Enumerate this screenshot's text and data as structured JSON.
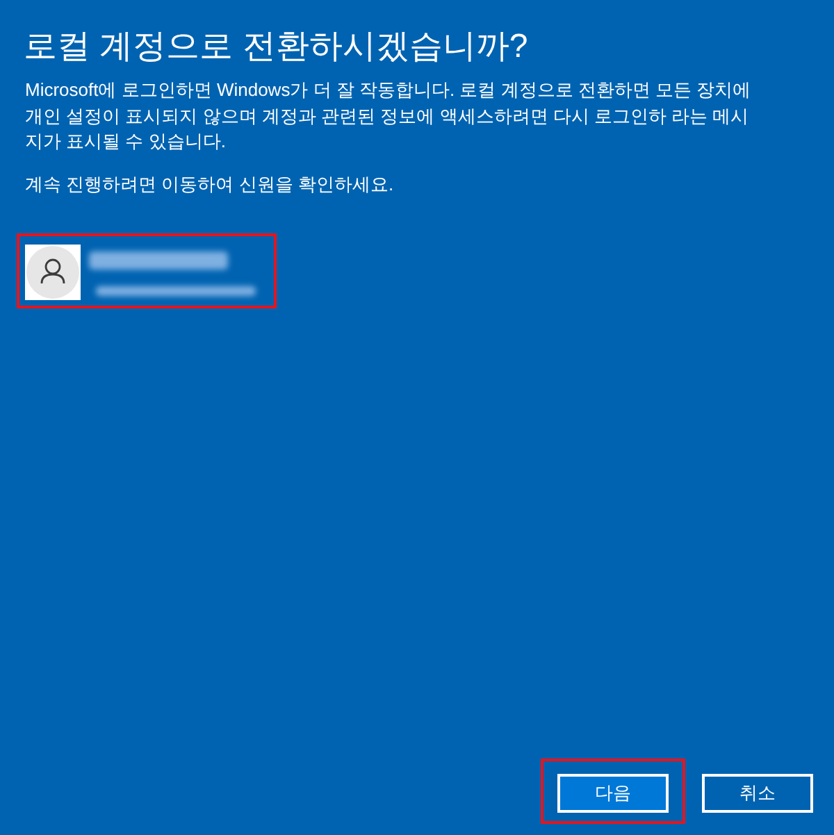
{
  "dialog": {
    "title": "로컬 계정으로 전환하시겠습니까?",
    "message": "Microsoft에 로그인하면 Windows가 더 잘 작동합니다. 로컬 계정으로 전환하면 모든 장치에 개인 설정이 표시되지 않으며 계정과 관련된 정보에 액세스하려면 다시 로그인하 라는 메시지가 표시될 수 있습니다.",
    "instruction": "계속 진행하려면 이동하여 신원을 확인하세요.",
    "account": {
      "highlighted": true
    },
    "buttons": [
      {
        "label": "다음",
        "kind": "primary",
        "highlighted": true
      },
      {
        "label": "취소",
        "kind": "secondary",
        "highlighted": false
      }
    ]
  }
}
